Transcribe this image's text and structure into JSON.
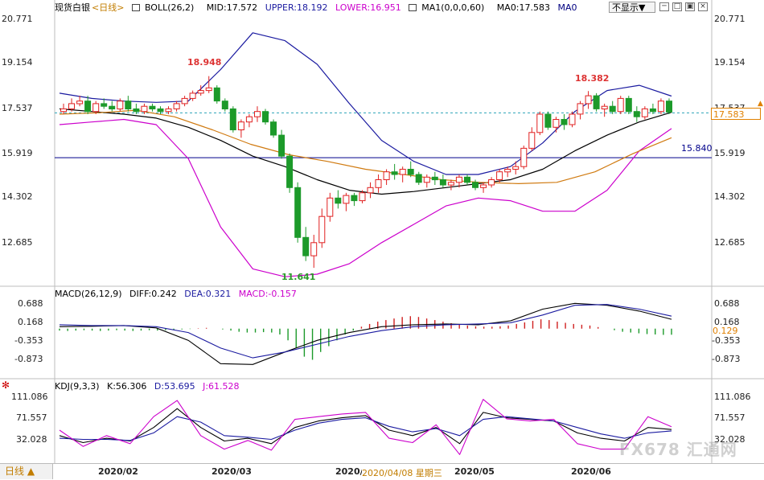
{
  "header": {
    "instrument": "现货白银",
    "period": "<日线>",
    "boll": "BOLL(26,2)",
    "boll_mid": "MID:17.572",
    "boll_upper": "UPPER:18.192",
    "boll_lower": "LOWER:16.951",
    "ma": "MA1(0,0,0,60)",
    "ma0": "MA0:17.583",
    "ma0b": "MA0",
    "dropdown": "不显示▼",
    "colors": {
      "mid": "#000000",
      "upper": "#1a1aa0",
      "lower": "#cc00cc",
      "ma": "#c86400"
    }
  },
  "macd_header": {
    "title": "MACD(26,12,9)",
    "diff": "DIFF:0.242",
    "dea": "DEA:0.321",
    "macd": "MACD:-0.157"
  },
  "kdj_header": {
    "title": "KDJ(9,3,3)",
    "k": "K:56.306",
    "d": "D:53.695",
    "j": "J:61.528"
  },
  "axes": {
    "price_ticks": [
      "20.771",
      "19.154",
      "17.537",
      "15.919",
      "14.302",
      "12.685"
    ],
    "macd_ticks": [
      "0.688",
      "0.168",
      "-0.353",
      "-0.873"
    ],
    "kdj_ticks": [
      "111.086",
      "71.557",
      "32.028"
    ],
    "dates": [
      "2020/02",
      "2020/03",
      "2020/04",
      "2020/05",
      "2020/06"
    ],
    "cursor_date": "2020/04/08 星期三"
  },
  "annotations": {
    "high1": "18.948",
    "low1": "11.641",
    "high2": "18.382",
    "hline_label": "15.840",
    "last_price": "17.583",
    "macd_value": "0.129",
    "macd_tick_dup": "0.168"
  },
  "bottom": {
    "period_label": "日线 ▲"
  },
  "watermark": "FX678 汇通网",
  "chart_data": [
    {
      "type": "candlestick",
      "title": "现货白银",
      "ylim": [
        11.0,
        21.3
      ],
      "candles": [
        [
          17.6,
          17.9,
          17.5,
          17.7
        ],
        [
          17.7,
          18.1,
          17.6,
          17.9
        ],
        [
          17.9,
          18.2,
          17.8,
          18.0
        ],
        [
          18.0,
          18.2,
          17.5,
          17.6
        ],
        [
          17.6,
          18.0,
          17.5,
          17.9
        ],
        [
          17.9,
          18.1,
          17.7,
          17.8
        ],
        [
          17.8,
          18.0,
          17.6,
          17.7
        ],
        [
          17.7,
          18.1,
          17.6,
          18.0
        ],
        [
          18.0,
          18.2,
          17.6,
          17.7
        ],
        [
          17.7,
          17.9,
          17.5,
          17.6
        ],
        [
          17.6,
          17.9,
          17.5,
          17.8
        ],
        [
          17.8,
          17.9,
          17.6,
          17.7
        ],
        [
          17.7,
          17.8,
          17.5,
          17.6
        ],
        [
          17.6,
          17.8,
          17.5,
          17.7
        ],
        [
          17.7,
          18.0,
          17.6,
          17.9
        ],
        [
          17.9,
          18.2,
          17.8,
          18.1
        ],
        [
          18.1,
          18.4,
          18.0,
          18.3
        ],
        [
          18.3,
          18.6,
          18.2,
          18.4
        ],
        [
          18.4,
          18.95,
          18.3,
          18.5
        ],
        [
          18.5,
          18.6,
          17.9,
          18.0
        ],
        [
          18.0,
          18.1,
          17.6,
          17.7
        ],
        [
          17.7,
          17.8,
          16.8,
          16.9
        ],
        [
          16.9,
          17.3,
          16.6,
          17.2
        ],
        [
          17.2,
          17.5,
          17.0,
          17.4
        ],
        [
          17.4,
          17.8,
          17.2,
          17.6
        ],
        [
          17.6,
          17.7,
          17.1,
          17.2
        ],
        [
          17.2,
          17.3,
          16.6,
          16.7
        ],
        [
          16.7,
          16.9,
          15.8,
          15.9
        ],
        [
          15.9,
          16.0,
          14.5,
          14.7
        ],
        [
          14.7,
          14.9,
          12.6,
          12.8
        ],
        [
          12.8,
          13.2,
          11.9,
          12.1
        ],
        [
          12.1,
          12.9,
          11.64,
          12.6
        ],
        [
          12.6,
          13.9,
          12.4,
          13.6
        ],
        [
          13.6,
          14.5,
          13.4,
          14.3
        ],
        [
          14.3,
          14.6,
          13.9,
          14.1
        ],
        [
          14.1,
          14.5,
          13.8,
          14.4
        ],
        [
          14.4,
          14.5,
          14.0,
          14.2
        ],
        [
          14.2,
          14.6,
          14.1,
          14.5
        ],
        [
          14.5,
          14.9,
          14.3,
          14.7
        ],
        [
          14.7,
          15.2,
          14.5,
          15.0
        ],
        [
          15.0,
          15.4,
          14.8,
          15.3
        ],
        [
          15.3,
          15.6,
          15.0,
          15.2
        ],
        [
          15.2,
          15.5,
          14.9,
          15.4
        ],
        [
          15.4,
          15.7,
          15.1,
          15.2
        ],
        [
          15.2,
          15.3,
          14.8,
          14.9
        ],
        [
          14.9,
          15.2,
          14.7,
          15.1
        ],
        [
          15.1,
          15.3,
          14.8,
          15.0
        ],
        [
          15.0,
          15.2,
          14.7,
          14.8
        ],
        [
          14.8,
          15.0,
          14.6,
          14.9
        ],
        [
          14.9,
          15.2,
          14.7,
          15.1
        ],
        [
          15.1,
          15.2,
          14.8,
          14.9
        ],
        [
          14.9,
          15.0,
          14.6,
          14.7
        ],
        [
          14.7,
          14.9,
          14.5,
          14.8
        ],
        [
          14.8,
          15.1,
          14.7,
          15.0
        ],
        [
          15.0,
          15.4,
          14.9,
          15.3
        ],
        [
          15.3,
          15.5,
          15.1,
          15.4
        ],
        [
          15.4,
          15.7,
          15.2,
          15.5
        ],
        [
          15.5,
          16.3,
          15.4,
          16.2
        ],
        [
          16.2,
          17.0,
          16.1,
          16.8
        ],
        [
          16.8,
          17.6,
          16.7,
          17.5
        ],
        [
          17.5,
          17.6,
          16.9,
          17.0
        ],
        [
          17.0,
          17.4,
          16.8,
          17.3
        ],
        [
          17.3,
          17.5,
          16.9,
          17.1
        ],
        [
          17.1,
          17.6,
          17.0,
          17.5
        ],
        [
          17.5,
          18.0,
          17.3,
          17.9
        ],
        [
          17.9,
          18.38,
          17.7,
          18.2
        ],
        [
          18.2,
          18.3,
          17.6,
          17.7
        ],
        [
          17.7,
          17.9,
          17.4,
          17.8
        ],
        [
          17.8,
          18.0,
          17.5,
          17.6
        ],
        [
          17.6,
          18.2,
          17.5,
          18.1
        ],
        [
          18.1,
          18.2,
          17.5,
          17.6
        ],
        [
          17.6,
          17.8,
          17.2,
          17.4
        ],
        [
          17.4,
          17.8,
          17.3,
          17.7
        ],
        [
          17.7,
          17.9,
          17.5,
          17.6
        ],
        [
          17.6,
          18.1,
          17.5,
          18.0
        ],
        [
          18.0,
          18.1,
          17.5,
          17.58
        ]
      ],
      "series": [
        {
          "name": "MID",
          "values": [
            17.7,
            17.6,
            17.5,
            17.35,
            17.0,
            16.5,
            15.9,
            15.5,
            15.0,
            14.6,
            14.45,
            14.55,
            14.7,
            14.85,
            15.0,
            15.4,
            16.1,
            16.7,
            17.2,
            17.57
          ]
        },
        {
          "name": "UPPER",
          "values": [
            18.3,
            18.1,
            18.0,
            17.95,
            18.0,
            19.2,
            20.6,
            20.3,
            19.4,
            17.9,
            16.5,
            15.7,
            15.2,
            15.2,
            15.5,
            16.4,
            17.6,
            18.4,
            18.6,
            18.19
          ]
        },
        {
          "name": "LOWER",
          "values": [
            17.1,
            17.2,
            17.3,
            17.1,
            15.8,
            13.2,
            11.6,
            11.3,
            11.4,
            11.8,
            12.6,
            13.3,
            14.0,
            14.3,
            14.2,
            13.8,
            13.8,
            14.6,
            16.1,
            16.95
          ]
        },
        {
          "name": "MA0",
          "values": [
            17.5,
            17.55,
            17.65,
            17.4,
            16.9,
            16.35,
            15.95,
            15.7,
            15.4,
            15.2,
            15.0,
            14.9,
            14.85,
            14.9,
            15.3,
            16.0,
            16.6
          ]
        }
      ],
      "hline": 15.84
    },
    {
      "type": "bar",
      "title": "MACD(26,12,9)",
      "ylim": [
        -1.1,
        0.8
      ],
      "histogram": [
        -0.05,
        -0.06,
        -0.05,
        -0.04,
        -0.05,
        -0.06,
        -0.05,
        -0.04,
        -0.05,
        -0.06,
        -0.05,
        -0.04,
        -0.05,
        -0.04,
        -0.03,
        -0.02,
        -0.01,
        0.01,
        0.02,
        0.0,
        -0.02,
        -0.05,
        -0.08,
        -0.1,
        -0.1,
        -0.09,
        -0.1,
        -0.15,
        -0.3,
        -0.5,
        -0.72,
        -0.8,
        -0.6,
        -0.45,
        -0.3,
        -0.15,
        -0.05,
        0.05,
        0.12,
        0.18,
        0.22,
        0.26,
        0.3,
        0.32,
        0.3,
        0.26,
        0.22,
        0.18,
        0.14,
        0.1,
        0.08,
        0.06,
        0.05,
        0.05,
        0.06,
        0.08,
        0.12,
        0.16,
        0.2,
        0.24,
        0.22,
        0.18,
        0.15,
        0.12,
        0.1,
        0.08,
        0.04,
        0.0,
        -0.04,
        -0.08,
        -0.1,
        -0.12,
        -0.14,
        -0.15,
        -0.16,
        -0.157
      ],
      "series": [
        {
          "name": "DIFF",
          "values": [
            0.05,
            0.06,
            0.08,
            0.02,
            -0.3,
            -0.9,
            -0.92,
            -0.6,
            -0.3,
            -0.1,
            0.05,
            0.1,
            0.12,
            0.1,
            0.2,
            0.5,
            0.65,
            0.6,
            0.45,
            0.24
          ]
        },
        {
          "name": "DEA",
          "values": [
            0.1,
            0.08,
            0.08,
            0.05,
            -0.1,
            -0.5,
            -0.75,
            -0.6,
            -0.4,
            -0.2,
            -0.05,
            0.05,
            0.1,
            0.12,
            0.15,
            0.35,
            0.6,
            0.62,
            0.5,
            0.32
          ]
        }
      ]
    },
    {
      "type": "line",
      "title": "KDJ(9,3,3)",
      "ylim": [
        0,
        125
      ],
      "series": [
        {
          "name": "K",
          "values": [
            45,
            32,
            40,
            35,
            60,
            95,
            60,
            35,
            40,
            30,
            60,
            72,
            78,
            82,
            55,
            45,
            60,
            30,
            88,
            78,
            75,
            72,
            50,
            40,
            35,
            60,
            56.3
          ]
        },
        {
          "name": "D",
          "values": [
            40,
            38,
            38,
            36,
            50,
            80,
            70,
            45,
            42,
            38,
            55,
            68,
            75,
            78,
            62,
            52,
            58,
            45,
            75,
            80,
            76,
            72,
            60,
            48,
            40,
            50,
            53.7
          ]
        },
        {
          "name": "J",
          "values": [
            55,
            25,
            45,
            30,
            80,
            110,
            45,
            20,
            36,
            18,
            75,
            80,
            85,
            88,
            40,
            32,
            65,
            10,
            112,
            76,
            72,
            75,
            30,
            20,
            20,
            80,
            61.5
          ]
        }
      ]
    }
  ]
}
